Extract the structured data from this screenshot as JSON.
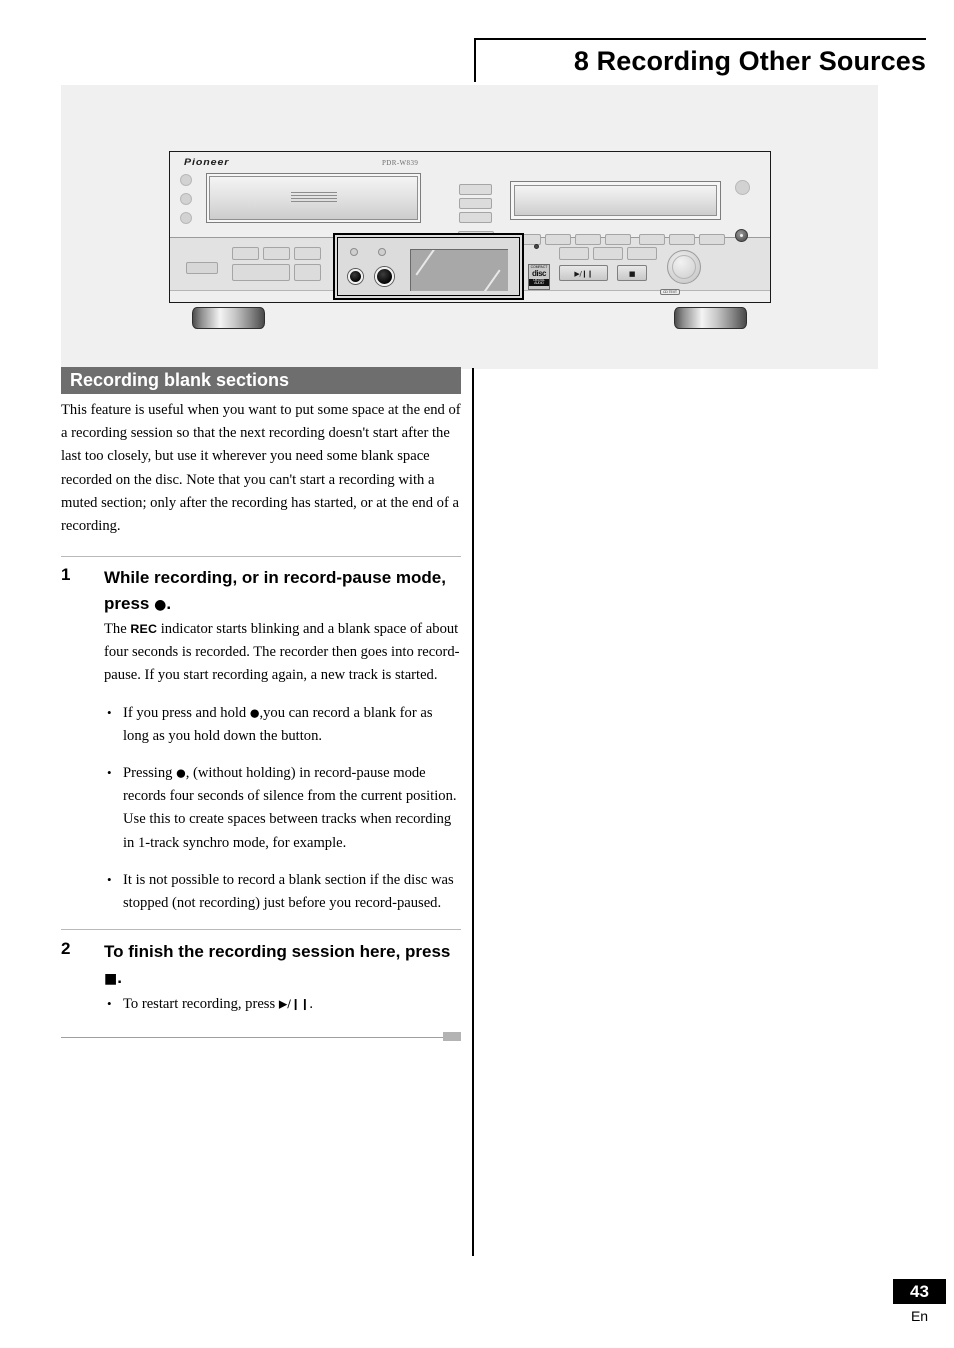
{
  "header": {
    "chapter_title": "8 Recording Other Sources"
  },
  "illustration": {
    "caption_name": "pioneer-cd-recorder-front-panel",
    "brand": "Pioneer",
    "model": "PDR-W839",
    "play_pause_button": "▶/❙❙",
    "stop_button": "■",
    "cd_logo_top": "COMPACT",
    "cd_logo_big": "disc",
    "cd_logo_bar": "DIGITAL AUDIO",
    "legacy_badge": "CD TEXT"
  },
  "section": {
    "heading": "Recording blank sections",
    "intro": "This feature is useful when you want to put some space at the end of a recording session so that the next recording doesn't start after the last too closely, but use it wherever you need some blank space recorded on the disc. Note that you can't start a recording with a muted section; only after the recording has started, or at the end of a recording."
  },
  "steps": [
    {
      "number": "1",
      "heading_before": "While recording, or in record-pause mode, press ",
      "heading_glyph": "●",
      "heading_after": ".",
      "body_before": "The ",
      "body_tag": "REC",
      "body_after": " indicator starts blinking and a blank space of about four seconds is recorded. The recorder then goes into record-pause. If you start recording again, a new track is started.",
      "bullets": [
        {
          "before": "If you press and hold ",
          "glyph": "●",
          "after": ",you can record a blank for as long as you hold down the button."
        },
        {
          "before": "Pressing ",
          "glyph": "●",
          "after": ", (without holding) in record-pause mode records four seconds of silence from the current position. Use this to create spaces between tracks when recording in 1-track synchro mode, for example."
        },
        {
          "before": "It is not possible to record a blank section if the disc was stopped (not recording) just before you record-paused.",
          "glyph": "",
          "after": ""
        }
      ]
    },
    {
      "number": "2",
      "heading_before": "To finish the recording session here, press ",
      "heading_glyph": "■",
      "heading_after": ".",
      "body_before": "",
      "body_tag": "",
      "body_after": "",
      "bullets": [
        {
          "before": "To restart recording, press ",
          "glyph": "▶/❙❙",
          "after": "."
        }
      ]
    }
  ],
  "footer": {
    "page_number": "43",
    "language": "En"
  },
  "colors": {
    "heading_bar": "#6e6e6e",
    "page_box": "#000000",
    "panel_background": "#f0f0f0"
  }
}
